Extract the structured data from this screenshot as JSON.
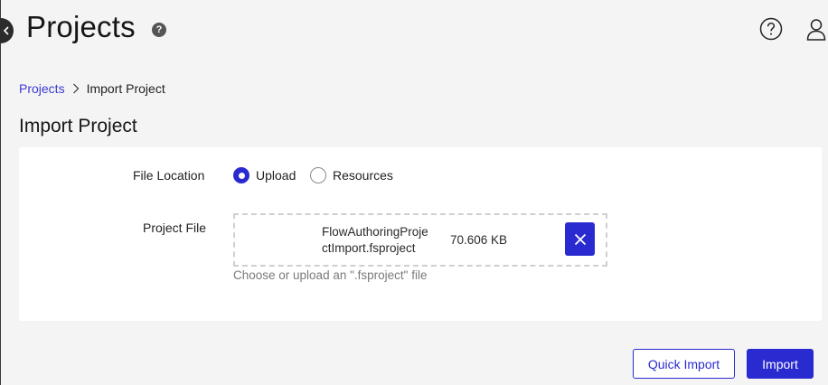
{
  "header": {
    "title": "Projects",
    "help_badge": "?",
    "icons": [
      "help-circle-icon",
      "user-icon"
    ]
  },
  "breadcrumb": {
    "parent": "Projects",
    "current": "Import Project"
  },
  "section_title": "Import Project",
  "form": {
    "file_location": {
      "label": "File Location",
      "options": [
        "Upload",
        "Resources"
      ],
      "selected": "Upload"
    },
    "project_file": {
      "label": "Project File",
      "file_name": "FlowAuthoringProjectImport.fsproject",
      "file_size": "70.606 KB",
      "hint": "Choose or upload an \".fsproject\" file"
    }
  },
  "actions": {
    "quick_import": "Quick Import",
    "import": "Import"
  },
  "colors": {
    "accent": "#2a2ad1",
    "link": "#3b3bd4",
    "background": "#f4f4f4",
    "card": "#ffffff",
    "hint_text": "#7a7a7a"
  }
}
